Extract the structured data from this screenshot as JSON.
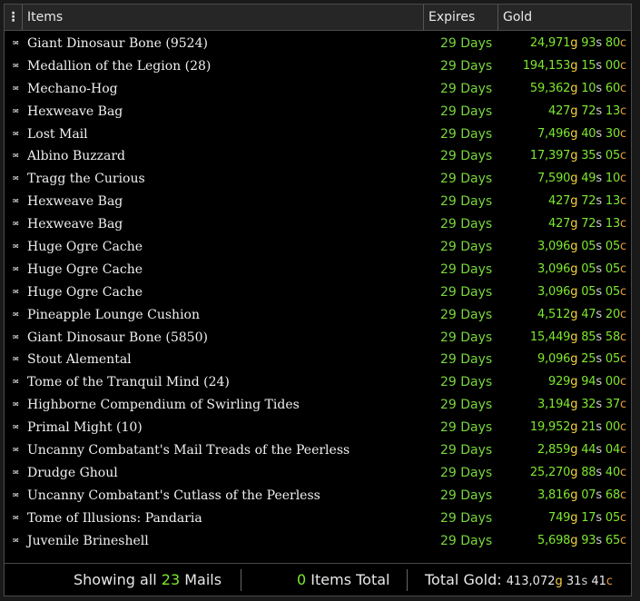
{
  "header": {
    "menu_glyph": "⋮",
    "items_label": "Items",
    "expires_label": "Expires",
    "gold_label": "Gold"
  },
  "rows": [
    {
      "name": "Giant Dinosaur Bone (9524)",
      "expires": "29 Days",
      "gold": "24,971",
      "silver": "93",
      "copper": "80"
    },
    {
      "name": "Medallion of the Legion (28)",
      "expires": "29 Days",
      "gold": "194,153",
      "silver": "15",
      "copper": "00"
    },
    {
      "name": "Mechano-Hog",
      "expires": "29 Days",
      "gold": "59,362",
      "silver": "10",
      "copper": "60"
    },
    {
      "name": "Hexweave Bag",
      "expires": "29 Days",
      "gold": "427",
      "silver": "72",
      "copper": "13"
    },
    {
      "name": "Lost Mail",
      "expires": "29 Days",
      "gold": "7,496",
      "silver": "40",
      "copper": "30"
    },
    {
      "name": "Albino Buzzard",
      "expires": "29 Days",
      "gold": "17,397",
      "silver": "35",
      "copper": "05"
    },
    {
      "name": "Tragg the Curious",
      "expires": "29 Days",
      "gold": "7,590",
      "silver": "49",
      "copper": "10"
    },
    {
      "name": "Hexweave Bag",
      "expires": "29 Days",
      "gold": "427",
      "silver": "72",
      "copper": "13"
    },
    {
      "name": "Hexweave Bag",
      "expires": "29 Days",
      "gold": "427",
      "silver": "72",
      "copper": "13"
    },
    {
      "name": "Huge Ogre Cache",
      "expires": "29 Days",
      "gold": "3,096",
      "silver": "05",
      "copper": "05"
    },
    {
      "name": "Huge Ogre Cache",
      "expires": "29 Days",
      "gold": "3,096",
      "silver": "05",
      "copper": "05"
    },
    {
      "name": "Huge Ogre Cache",
      "expires": "29 Days",
      "gold": "3,096",
      "silver": "05",
      "copper": "05"
    },
    {
      "name": "Pineapple Lounge Cushion",
      "expires": "29 Days",
      "gold": "4,512",
      "silver": "47",
      "copper": "20"
    },
    {
      "name": "Giant Dinosaur Bone (5850)",
      "expires": "29 Days",
      "gold": "15,449",
      "silver": "85",
      "copper": "58"
    },
    {
      "name": "Stout Alemental",
      "expires": "29 Days",
      "gold": "9,096",
      "silver": "25",
      "copper": "05"
    },
    {
      "name": "Tome of the Tranquil Mind (24)",
      "expires": "29 Days",
      "gold": "929",
      "silver": "94",
      "copper": "00"
    },
    {
      "name": "Highborne Compendium of Swirling Tides",
      "expires": "29 Days",
      "gold": "3,194",
      "silver": "32",
      "copper": "37"
    },
    {
      "name": "Primal Might (10)",
      "expires": "29 Days",
      "gold": "19,952",
      "silver": "21",
      "copper": "00"
    },
    {
      "name": "Uncanny Combatant's Mail Treads of the Peerless",
      "expires": "29 Days",
      "gold": "2,859",
      "silver": "44",
      "copper": "04"
    },
    {
      "name": "Drudge Ghoul",
      "expires": "29 Days",
      "gold": "25,270",
      "silver": "88",
      "copper": "40"
    },
    {
      "name": "Uncanny Combatant's Cutlass of the Peerless",
      "expires": "29 Days",
      "gold": "3,816",
      "silver": "07",
      "copper": "68"
    },
    {
      "name": "Tome of Illusions: Pandaria",
      "expires": "29 Days",
      "gold": "749",
      "silver": "17",
      "copper": "05"
    },
    {
      "name": "Juvenile Brineshell",
      "expires": "29 Days",
      "gold": "5,698",
      "silver": "93",
      "copper": "65"
    }
  ],
  "currency": {
    "g": "g",
    "s": "s",
    "c": "c"
  },
  "row_icon": "mail-icon",
  "row_icon_glyph": "✉",
  "footer": {
    "showing_prefix": "Showing all",
    "mail_count": "23",
    "showing_suffix": "Mails",
    "items_count": "0",
    "items_suffix": "Items Total",
    "total_label": "Total Gold:",
    "total_gold": "413,072",
    "total_silver": "31",
    "total_copper": "41"
  },
  "colors": {
    "expires": "#78d63c",
    "number": "#7de82e",
    "gold_suffix": "#f5d442",
    "silver_suffix": "#cfcfcf",
    "copper_suffix": "#e89a3c",
    "background": "#000000"
  }
}
